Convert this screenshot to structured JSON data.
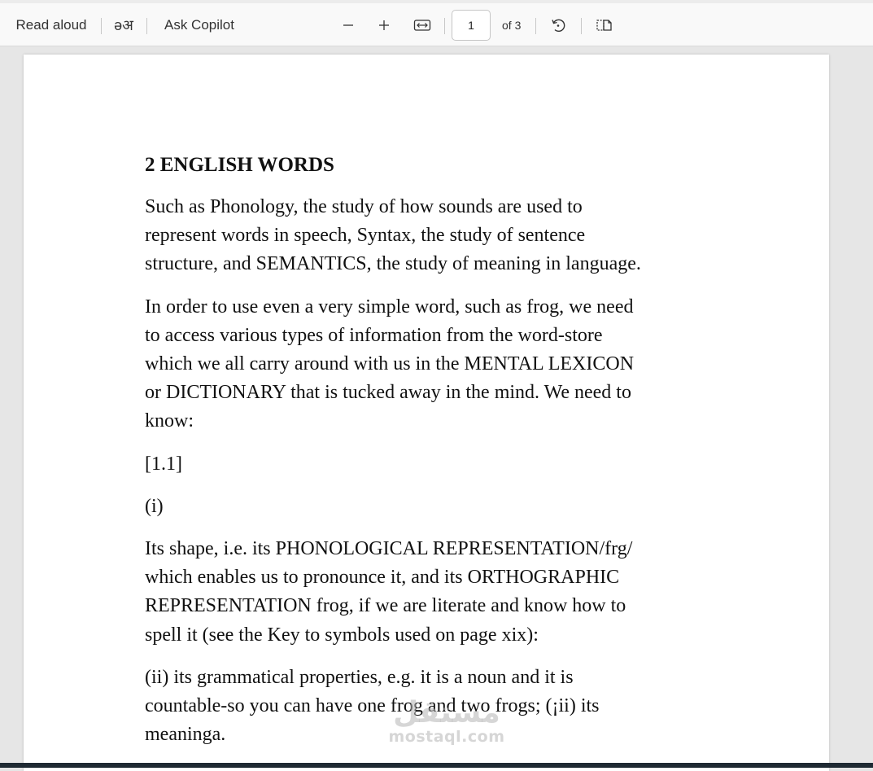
{
  "toolbar": {
    "read_aloud_label": "Read aloud",
    "translate_label": "əअ",
    "ask_copilot_label": "Ask Copilot",
    "zoom_out_icon": "minus-icon",
    "zoom_in_icon": "plus-icon",
    "fit_width_icon": "fit-width-icon",
    "page_number_value": "1",
    "page_count_label": "of 3",
    "rotate_icon": "rotate-icon",
    "two_page_icon": "page-view-icon"
  },
  "document": {
    "heading": "2 ENGLISH WORDS",
    "paragraphs": [
      "Such as Phonology, the study of how sounds are used to\nrepresent words in speech, Syntax, the study of sentence\nstructure, and SEMANTICS, the study of meaning in language.",
      "In order to use even a very simple word, such as frog, we need\nto access various types of information from the word-store\nwhich we all carry around with us in the MENTAL LEXICON\nor DICTIONARY that is tucked away in the mind. We need to\nknow:",
      "[1.1]",
      "(i)",
      "Its shape, i.e. its PHONOLOGICAL REPRESENTATION/frg/\nwhich enables us to pronounce it, and its ORTHOGRAPHIC\nREPRESENTATION frog, if we are literate and know how to\nspell it (see the Key to symbols used on page xix):",
      "(ii) its grammatical properties, e.g. it is a noun and it is\ncountable-so you can have one frog and two frogs; (¡ii) its\nmeaninga."
    ]
  },
  "watermark": {
    "arabic": "مستقل",
    "latin": "mostaql.com"
  },
  "colors": {
    "toolbar_bg": "#f9f9f9",
    "viewer_bg": "#e6e6e6",
    "page_bg": "#ffffff",
    "text": "#111111"
  }
}
